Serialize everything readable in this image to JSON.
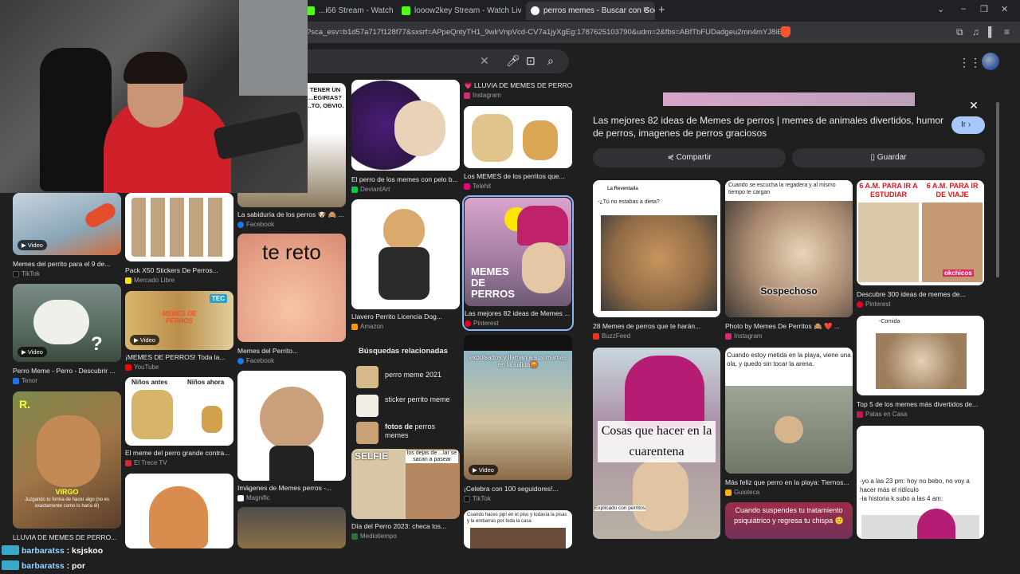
{
  "tabs": [
    {
      "label": "...i66 Stream - Watch Live on",
      "icon": "kick-icon"
    },
    {
      "label": "looow2key Stream - Watch Live on",
      "icon": "kick-icon"
    },
    {
      "label": "perros memes - Buscar con Goo",
      "icon": "google-icon"
    }
  ],
  "url": "?sca_esv=b1d57a717f128f77&sxsrf=APpeQntyTH1_9wlrVnpVcd-CV7a1jyXgEg:1787625103790&udm=2&fbs=ABfTbFUDadgeu2mn4mYJ8iE...",
  "colors": {
    "accent": "#a8c7fa",
    "panel": "#1f1f1f",
    "kick": "#53fc18"
  },
  "results": {
    "col1": [
      {
        "caption": "Memes del perrito para el 9 de...",
        "source": "TikTok",
        "video": "Video"
      },
      {
        "caption": "Perro Meme - Perro - Descubrir ...",
        "source": "Tenor",
        "video": "Video"
      },
      {
        "caption": "LLUVIA DE MEMES DE PERRO...",
        "source": "",
        "overlay": "VIRGO",
        "overlay2": "Juzgando tu forma de hacer algo (no es exactamente como lo haría él)",
        "overlay_r": "R."
      }
    ],
    "col2": [
      {
        "caption": "Pack X50 Stickers De Perros...",
        "source": "Mercado Libre"
      },
      {
        "caption": "¡MEMES DE PERROS! Toda la...",
        "source": "YouTube",
        "video": "Video",
        "overlay": "MEMES DE PERROS",
        "badge": "TEC"
      },
      {
        "caption": "El meme del perro grande contra...",
        "source": "El Trece TV",
        "overlay": "Niños antes",
        "overlay2": "Niños ahora"
      }
    ],
    "col3": [
      {
        "caption": "La sabiduría de los perros 🐶 🙈 ...",
        "source": "Facebook",
        "overlay": "TENER UN ...EGIRIAS? ...TO, OBVIO."
      },
      {
        "caption": "Memes del Perrito...",
        "source": "Facebook",
        "overlay": "te reto"
      },
      {
        "caption": "Imágenes de Memes perros -...",
        "source": "Magnific"
      }
    ],
    "col4": [
      {
        "caption": "El perro de los memes con pelo b...",
        "source": "DeviantArt"
      },
      {
        "caption": "Llavero Perrito Licencia Dog...",
        "source": "Amazon"
      },
      {
        "caption": "Día del Perro 2023: checa los...",
        "source": "Mediotiempo",
        "overlay": "SELFIE",
        "overlay2": "los dejas de ...lar se sacan a pasear"
      }
    ],
    "col5": [
      {
        "caption": "💗 LLUVIA DE MEMES DE PERRO...",
        "source": "Instagram"
      },
      {
        "caption": "Los MEMES de los perritos que...",
        "source": "Telehit"
      },
      {
        "caption": "Las mejores 82 ideas de Memes ...",
        "source": "Pinterest",
        "overlay": "MEMES DE PERROS"
      },
      {
        "caption": "¡Celebra con 100 seguidores!...",
        "source": "TikTok",
        "video": "Video",
        "overlay": "expulsados y llaman a sus mamás en la salida😡"
      },
      {
        "caption": "",
        "source": "",
        "overlay": "Cuando haces pipí en el piso y todavía la pisas y la embarras por toda la casa"
      }
    ]
  },
  "related": {
    "heading": "Búsquedas relacionadas",
    "items": [
      {
        "plain": "perro meme 2021",
        "bold": ""
      },
      {
        "plain": "sticker perrito meme",
        "bold": ""
      },
      {
        "bold": "fotos de",
        "plain": " perros memes"
      }
    ]
  },
  "panel": {
    "title": "Las mejores 82 ideas de Memes de perros | memes de animales divertidos, humor de perros, imagenes de perros graciosos",
    "go_button": "Ir",
    "share": "Compartir",
    "save": "Guardar",
    "items": [
      {
        "caption": "28 Memes de perros que te harán...",
        "source": "BuzzFeed",
        "overlay_user": "La Reventalla",
        "overlay": "-¿Tú no estabas a dieta?"
      },
      {
        "caption": "Photo by Memes De Perritos 🙈 ❤️ ...",
        "source": "Instagram",
        "overlay": "Cuando se escucha la regadera y al mismo tiempo te cargan",
        "overlay2": "Sospechoso"
      },
      {
        "caption": "Descubre 300 ideas de memes de...",
        "source": "Pinterest",
        "overlay": "6 A.M. PARA IR A ESTUDIAR",
        "overlay2": "6 A.M. PARA IR DE VIAJE",
        "badge": "okchicos"
      },
      {
        "caption": "Top 5 de los memes más divertidos de...",
        "source": "Patas en Casa",
        "overlay": "-Comida"
      },
      {
        "caption": "Más feliz que perro en la playa: Tiernos...",
        "source": "Guioteca",
        "overlay": "Cuando estoy metida en la playa, viene una ola, y quedo sin tocar la arena."
      },
      {
        "caption": "",
        "source": "",
        "overlay": "Cosas que hacer en la cuarentena",
        "overlay2": "Explicado con perritos"
      },
      {
        "caption": "",
        "source": "",
        "overlay": "Cuando suspendes tu tratamiento psiquiátrico y regresa tu chispa 🙂"
      },
      {
        "caption": "",
        "source": "",
        "overlay": "-yo a las 23 pm: hoy no bebo, no voy a hacer más el ridículo\n-la historia k subo a las 4 am:"
      }
    ]
  },
  "chat": [
    {
      "user": "barbaratss",
      "text": " : ksjskoo"
    },
    {
      "user": "barbaratss",
      "text": " : por"
    }
  ]
}
